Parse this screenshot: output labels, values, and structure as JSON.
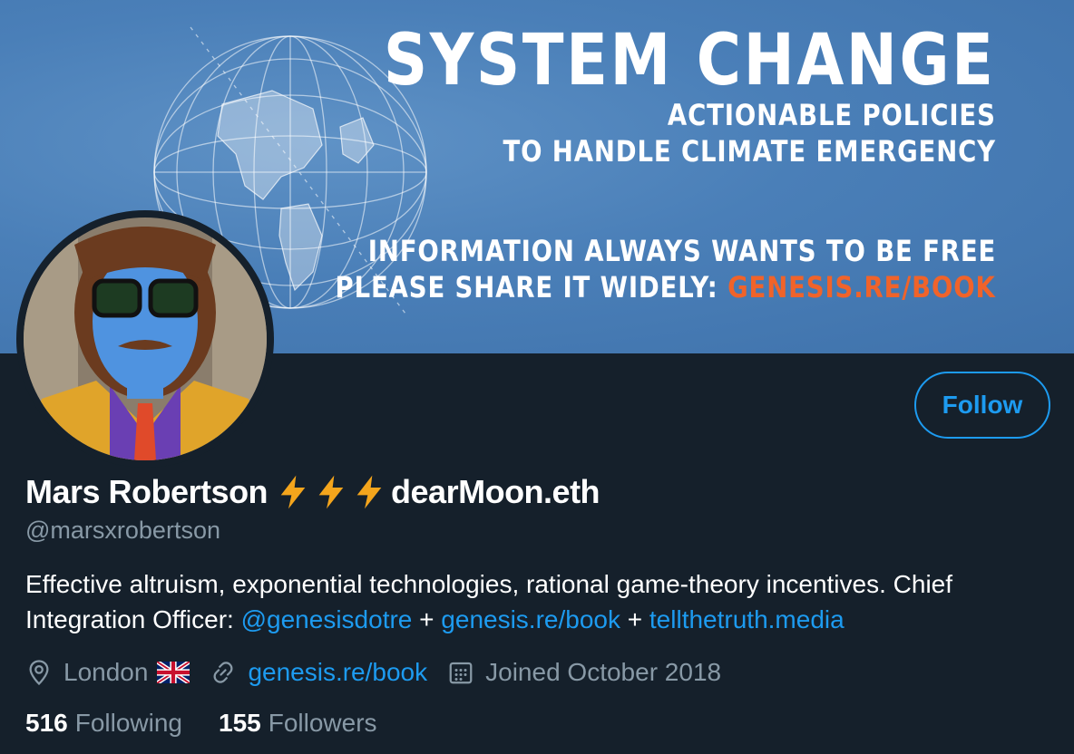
{
  "banner": {
    "title": "SYSTEM CHANGE",
    "subtitle_line1": "ACTIONABLE POLICIES",
    "subtitle_line2": "TO HANDLE CLIMATE EMERGENCY",
    "info_line1": "INFORMATION ALWAYS WANTS TO BE FREE",
    "info_line2_prefix": "PLEASE SHARE IT WIDELY: ",
    "info_line2_link": "GENESIS.RE/BOOK",
    "link_color": "#f0632a"
  },
  "profile": {
    "name_prefix": "Mars Robertson ",
    "name_emoji": "⚡⚡⚡",
    "name_suffix": "dearMoon.eth",
    "handle": "@marsxrobertson",
    "bio_text1": "Effective altruism, exponential technologies, rational game-theory incentives. Chief Integration Officer: ",
    "bio_link1": "@genesisdotre",
    "bio_sep1": " + ",
    "bio_link2": "genesis.re/book",
    "bio_sep2": " + ",
    "bio_link3": "tellthetruth.media",
    "location": "London",
    "location_flag": "🇬🇧",
    "website": "genesis.re/book",
    "joined": "Joined October 2018",
    "following_count": "516",
    "following_label": "Following",
    "followers_count": "155",
    "followers_label": "Followers"
  },
  "actions": {
    "follow_label": "Follow"
  },
  "colors": {
    "background": "#15202b",
    "accent": "#1d9bf0",
    "muted": "#8899a6",
    "bolt": "#f4a51c"
  },
  "icons": [
    "location-pin-icon",
    "link-icon",
    "calendar-icon",
    "lightning-bolt-icon",
    "uk-flag-icon"
  ]
}
